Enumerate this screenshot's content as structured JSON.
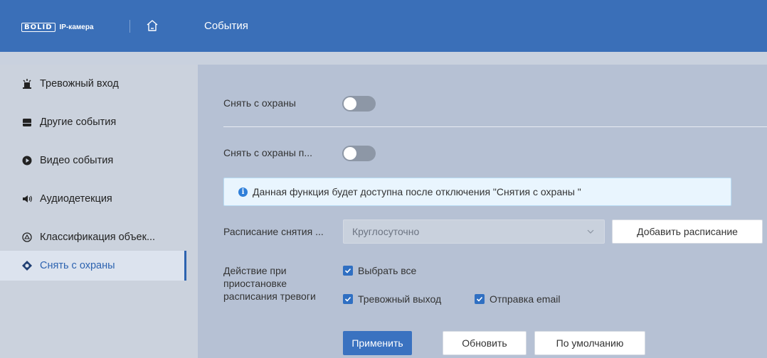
{
  "header": {
    "logo_brand": "BOLID",
    "logo_text": "IP-камера",
    "title": "События",
    "home_icon": "home-icon"
  },
  "sidebar": {
    "items": [
      {
        "label": "Тревожный вход",
        "icon": "alarm-input-icon"
      },
      {
        "label": "Другие события",
        "icon": "storage-event-icon"
      },
      {
        "label": "Видео события",
        "icon": "video-event-icon"
      },
      {
        "label": "Аудиодетекция",
        "icon": "speaker-icon"
      },
      {
        "label": "Классификация объек...",
        "icon": "classification-icon"
      },
      {
        "label": "Снять с охраны",
        "icon": "disarm-icon",
        "active": true
      }
    ]
  },
  "main": {
    "disarm_label": "Снять с охраны",
    "disarm_enabled": false,
    "disarm_schedule_label": "Снять с охраны п...",
    "disarm_schedule_enabled": false,
    "info_text": "Данная функция будет доступна после отключения \"Снятия с охраны \"",
    "schedule_label": "Расписание снятия ...",
    "schedule_value": "Круглосуточно",
    "add_schedule_label": "Добавить расписание",
    "action_label_lines": [
      "Действие при",
      "приостановке",
      "расписания тревоги"
    ],
    "select_all_label": "Выбрать все",
    "alarm_output_label": "Тревожный выход",
    "email_label": "Отправка email",
    "apply_label": "Применить",
    "refresh_label": "Обновить",
    "default_label": "По умолчанию"
  },
  "colors": {
    "header_bg": "#3a6fb8",
    "accent": "#2d63b0",
    "content_bg": "#b6c1d4",
    "sidebar_bg": "#cbd2dd"
  }
}
